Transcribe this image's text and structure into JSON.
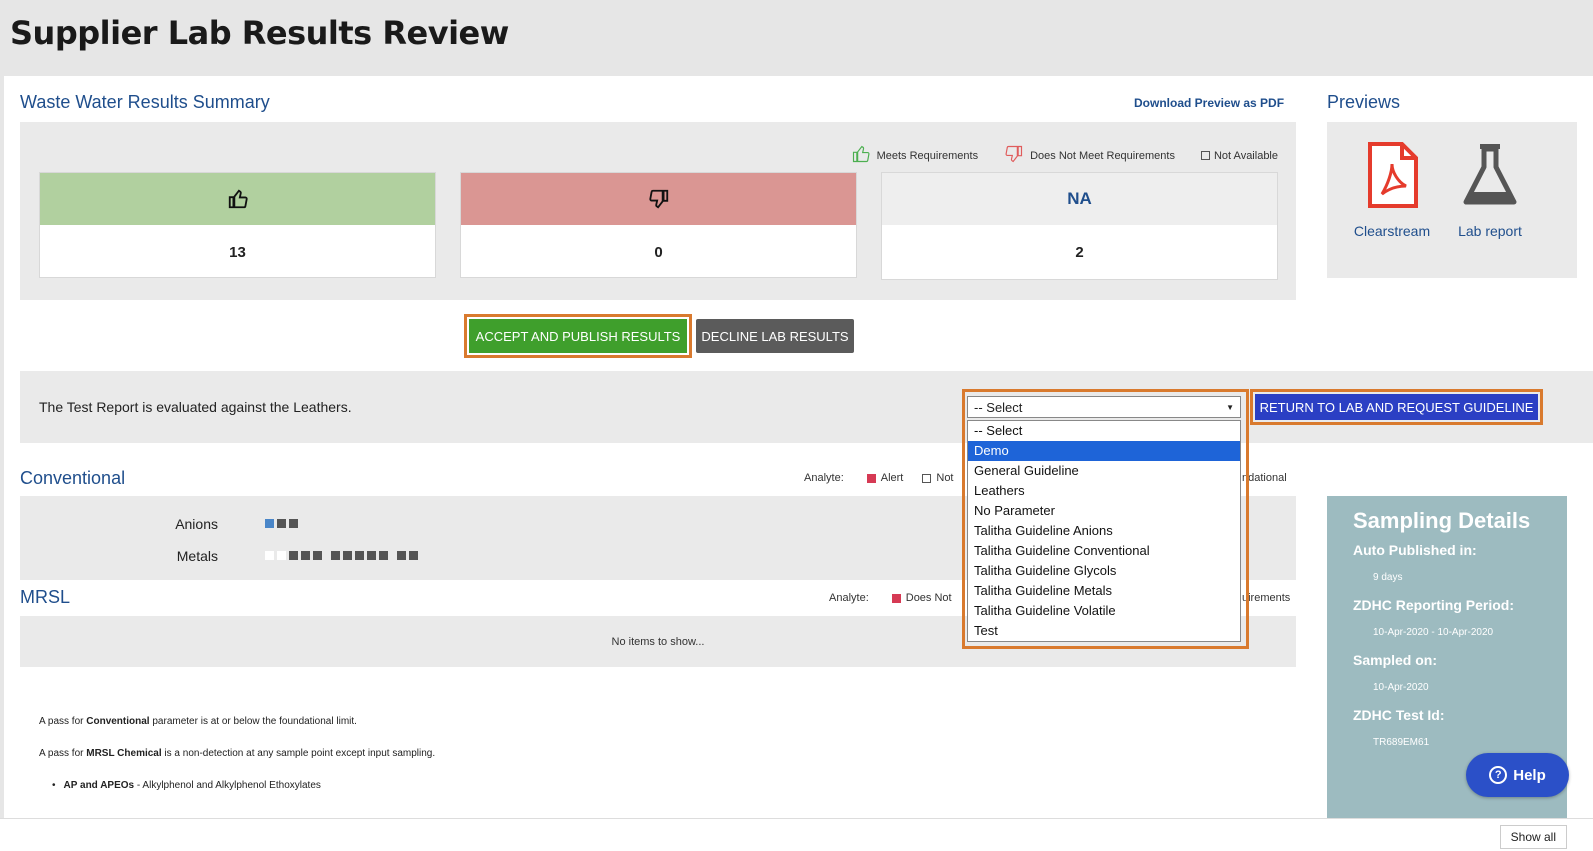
{
  "page": {
    "title": "Supplier Lab Results Review"
  },
  "summary": {
    "title": "Waste Water Results Summary",
    "download_link": "Download Preview as PDF",
    "legend": {
      "meets": "Meets Requirements",
      "not_meet": "Does Not Meet Requirements",
      "na": "Not Available"
    },
    "cards": {
      "meets_value": "13",
      "not_meet_value": "0",
      "na_label": "NA",
      "na_value": "2"
    }
  },
  "previews": {
    "title": "Previews",
    "items": [
      {
        "label": "Clearstream",
        "icon": "pdf-icon"
      },
      {
        "label": "Lab report",
        "icon": "flask-icon"
      }
    ]
  },
  "actions": {
    "accept": "ACCEPT AND PUBLISH RESULTS",
    "decline": "DECLINE LAB RESULTS",
    "return": "RETURN TO LAB AND REQUEST GUIDELINE"
  },
  "guideline": {
    "text": "The Test Report is evaluated against the Leathers.",
    "selected": "-- Select",
    "options": [
      "-- Select",
      "Demo",
      "General Guideline",
      "Leathers",
      "No Parameter",
      "Talitha Guideline Anions",
      "Talitha Guideline Conventional",
      "Talitha Guideline Glycols",
      "Talitha Guideline Metals",
      "Talitha Guideline Volatile",
      "Test"
    ],
    "highlighted": "Demo"
  },
  "conventional": {
    "title": "Conventional",
    "analyte_label": "Analyte:",
    "legend_alert": "Alert",
    "legend_not": "Not",
    "legend_tail": "ndational",
    "rows": [
      {
        "label": "Anions"
      },
      {
        "label": "Metals"
      }
    ]
  },
  "mrsl": {
    "title": "MRSL",
    "analyte_label": "Analyte:",
    "legend_doesnot": "Does Not",
    "legend_tail": "uirements",
    "empty": "No items to show..."
  },
  "notes": {
    "line1_pre": "A pass for ",
    "line1_bold": "Conventional",
    "line1_post": " parameter is at or below the foundational limit.",
    "line2_pre": "A pass for ",
    "line2_bold": "MRSL Chemical",
    "line2_post": " is a non-detection at any sample point except input sampling.",
    "bullet_bold": "AP and APEOs",
    "bullet_text": " - Alkylphenol and Alkylphenol Ethoxylates"
  },
  "sampling": {
    "title": "Sampling Details",
    "auto_published_label": "Auto Published in:",
    "auto_published_value": "9 days",
    "period_label": "ZDHC Reporting Period:",
    "period_value": "10-Apr-2020 - 10-Apr-2020",
    "sampled_label": "Sampled on:",
    "sampled_value": "10-Apr-2020",
    "test_id_label": "ZDHC Test Id:",
    "test_id_value": "TR689EM61"
  },
  "help": {
    "label": "Help"
  },
  "bottom": {
    "show_all": "Show all"
  },
  "colors": {
    "accent_blue": "#1f4e8c",
    "accept_green": "#3f9f2c",
    "return_blue": "#2b3fc4",
    "highlight_orange": "#d97a2e",
    "meets_green": "#b1d09f",
    "not_meet_red": "#da9693",
    "sampling_bg": "#9dbbc0"
  }
}
